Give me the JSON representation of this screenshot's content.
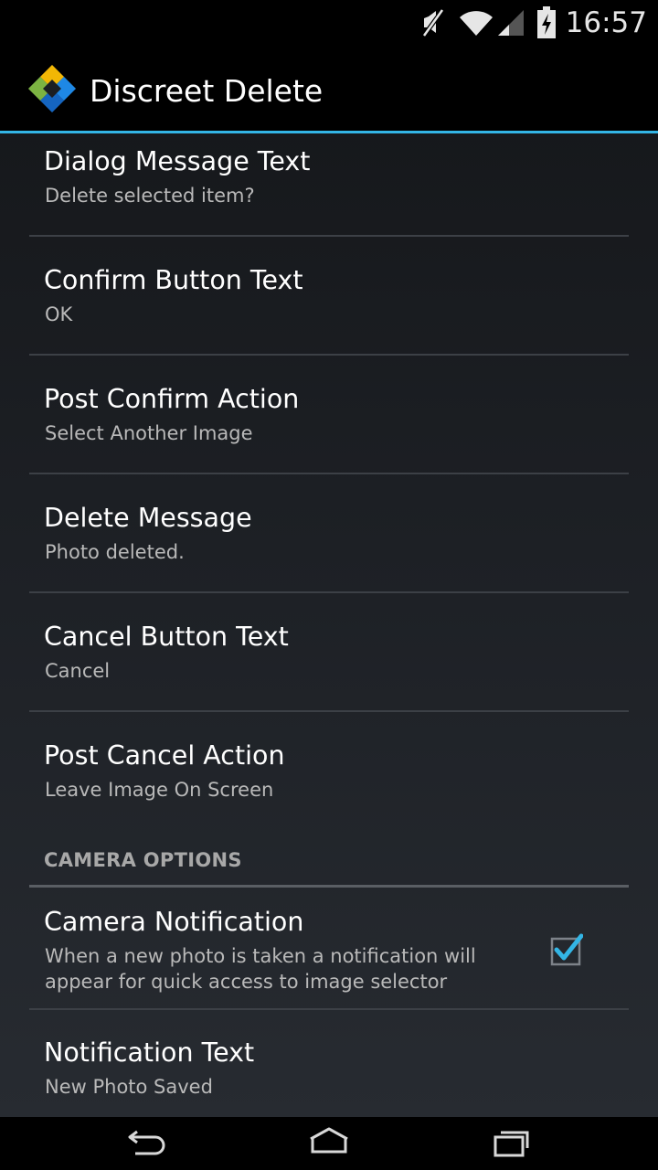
{
  "status_bar": {
    "time": "16:57",
    "icons": [
      "mute-icon",
      "wifi-icon",
      "signal-icon",
      "battery-charging-icon"
    ]
  },
  "action_bar": {
    "title": "Discreet Delete",
    "icon": "app-logo-icon"
  },
  "preferences": [
    {
      "title": "Dialog Message Text",
      "summary": "Delete selected item?"
    },
    {
      "title": "Confirm Button Text",
      "summary": "OK"
    },
    {
      "title": "Post Confirm Action",
      "summary": "Select Another Image"
    },
    {
      "title": "Delete Message",
      "summary": "Photo deleted."
    },
    {
      "title": "Cancel Button Text",
      "summary": "Cancel"
    },
    {
      "title": "Post Cancel Action",
      "summary": "Leave Image On Screen"
    }
  ],
  "camera_category": {
    "title": "CAMERA OPTIONS",
    "items": [
      {
        "title": "Camera Notification",
        "summary": "When a new photo is taken a notification will appear for quick access to image selector",
        "checked": true
      },
      {
        "title": "Notification Text",
        "summary": "New Photo Saved"
      }
    ]
  },
  "nav_bar": {
    "icons": [
      "back-icon",
      "home-icon",
      "recent-apps-icon"
    ]
  },
  "colors": {
    "accent": "#33b5e5",
    "background_top": "#141619",
    "background_bottom": "#272b31",
    "title_text": "#ffffff",
    "summary_text": "#b9b9b9"
  }
}
